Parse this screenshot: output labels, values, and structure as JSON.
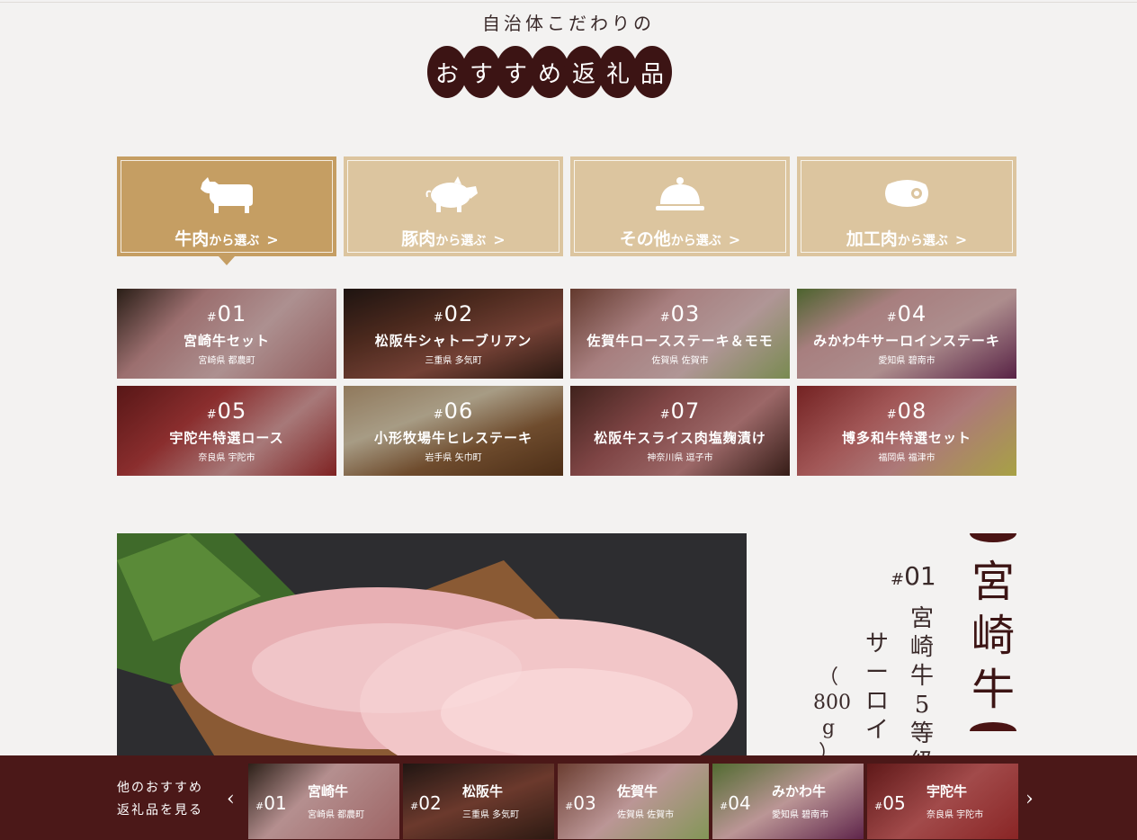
{
  "header": {
    "subtitle": "自治体こだわりの",
    "title_chars": [
      "お",
      "す",
      "す",
      "め",
      "返",
      "礼",
      "品"
    ]
  },
  "categories": [
    {
      "main": "牛肉",
      "small": "から選ぶ",
      "chevron": ">",
      "icon": "cow-icon",
      "active": true
    },
    {
      "main": "豚肉",
      "small": "から選ぶ",
      "chevron": ">",
      "icon": "pig-icon",
      "active": false
    },
    {
      "main": "その他",
      "small": "から選ぶ",
      "chevron": ">",
      "icon": "cloche-icon",
      "active": false
    },
    {
      "main": "加工肉",
      "small": "から選ぶ",
      "chevron": ">",
      "icon": "meat-icon",
      "active": false
    }
  ],
  "items": [
    {
      "hash": "#",
      "num": "01",
      "name": "宮崎牛セット",
      "location": "宮崎県 都農町"
    },
    {
      "hash": "#",
      "num": "02",
      "name": "松阪牛シャトーブリアン",
      "location": "三重県 多気町"
    },
    {
      "hash": "#",
      "num": "03",
      "name": "佐賀牛ロースステーキ＆モモ",
      "location": "佐賀県 佐賀市"
    },
    {
      "hash": "#",
      "num": "04",
      "name": "みかわ牛サーロインステーキ",
      "location": "愛知県 碧南市"
    },
    {
      "hash": "#",
      "num": "05",
      "name": "宇陀牛特選ロース",
      "location": "奈良県 宇陀市"
    },
    {
      "hash": "#",
      "num": "06",
      "name": "小形牧場牛ヒレステーキ",
      "location": "岩手県 矢巾町"
    },
    {
      "hash": "#",
      "num": "07",
      "name": "松阪牛スライス肉塩麹漬け",
      "location": "神奈川県 逗子市"
    },
    {
      "hash": "#",
      "num": "08",
      "name": "博多和牛特選セット",
      "location": "福岡県 福津市"
    }
  ],
  "feature": {
    "hash": "#",
    "number": "01",
    "brand_chars": [
      "宮",
      "崎",
      "牛"
    ],
    "desc_col1_chars": [
      "宮",
      "崎",
      "牛",
      "5",
      "等",
      "級"
    ],
    "desc_col2_chars": [
      "サ",
      "ー",
      "ロ",
      "イ"
    ],
    "weight_chars": [
      "（",
      "800",
      "g",
      "）"
    ]
  },
  "bottom_bar": {
    "label_line1": "他のおすすめ",
    "label_line2": "返礼品を見る",
    "prev": "‹",
    "next": "›",
    "thumbs": [
      {
        "hash": "#",
        "num": "01",
        "name": "宮崎牛",
        "location": "宮崎県 都農町"
      },
      {
        "hash": "#",
        "num": "02",
        "name": "松阪牛",
        "location": "三重県 多気町"
      },
      {
        "hash": "#",
        "num": "03",
        "name": "佐賀牛",
        "location": "佐賀県 佐賀市"
      },
      {
        "hash": "#",
        "num": "04",
        "name": "みかわ牛",
        "location": "愛知県 碧南市"
      },
      {
        "hash": "#",
        "num": "05",
        "name": "宇陀牛",
        "location": "奈良県 宇陀市"
      }
    ]
  },
  "colors": {
    "brand_dark": "#3c1414",
    "category_active": "#c59e63",
    "category_inactive": "#dcc59f",
    "bottom_bar": "#4b1818"
  }
}
